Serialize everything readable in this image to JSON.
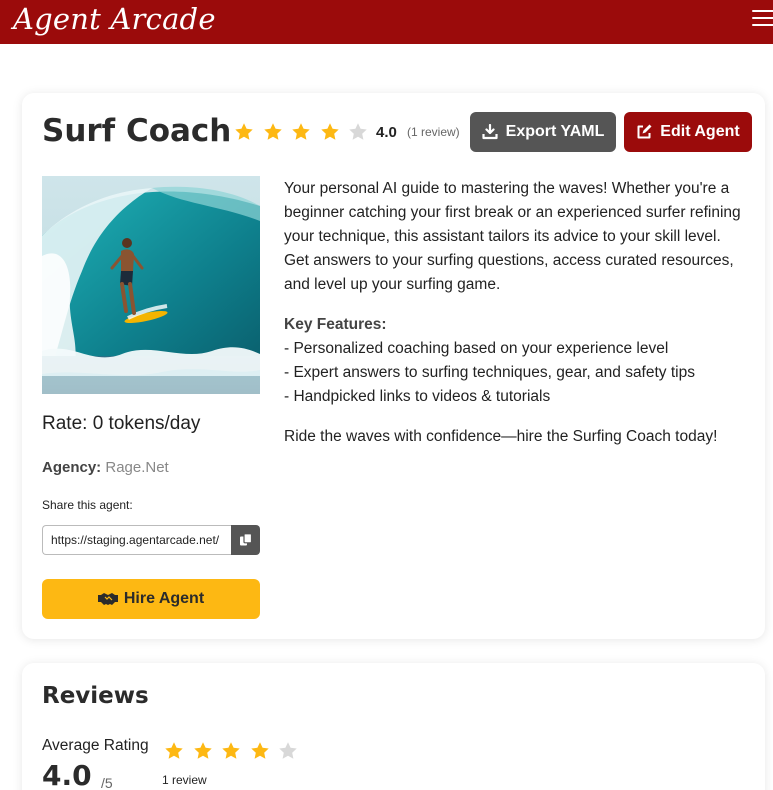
{
  "app": {
    "brand": "Agent Arcade"
  },
  "agent": {
    "title": "Surf Coach",
    "rating": 4,
    "rating_label": "4.0",
    "review_count_label": "(1 review)",
    "rate_label": "Rate: 0 tokens/day",
    "agency_label": "Agency:",
    "agency_value": "Rage.Net",
    "share_label": "Share this agent:",
    "share_url": "https://staging.agentarcade.net/",
    "image_icon": "surfer-photo"
  },
  "toolbar": {
    "export_label": "Export YAML",
    "edit_label": "Edit Agent",
    "hire_label": "Hire Agent"
  },
  "description": {
    "intro": "Your personal AI guide to mastering the waves! Whether you're a beginner catching your first break or an experienced surfer refining your technique, this assistant tailors its advice to your skill level. Get answers to your surfing questions, access curated resources, and level up your surfing game.",
    "features_title": "Key Features:",
    "features": [
      "- Personalized coaching based on your experience level",
      "- Expert answers to surfing techniques, gear, and safety tips",
      "- Handpicked links to videos & tutorials"
    ],
    "closing": "Ride the waves with confidence—hire the Surfing Coach today!"
  },
  "reviews": {
    "title": "Reviews",
    "avg_label": "Average Rating",
    "avg_value": "4.0",
    "avg_max": "/5",
    "count_label": "1 review",
    "rating": 4
  },
  "colors": {
    "brand": "#9b0b0b",
    "star_filled": "#fdb813",
    "star_empty": "#d8d8d8",
    "hire_button": "#fdb813",
    "export_button": "#555555"
  }
}
